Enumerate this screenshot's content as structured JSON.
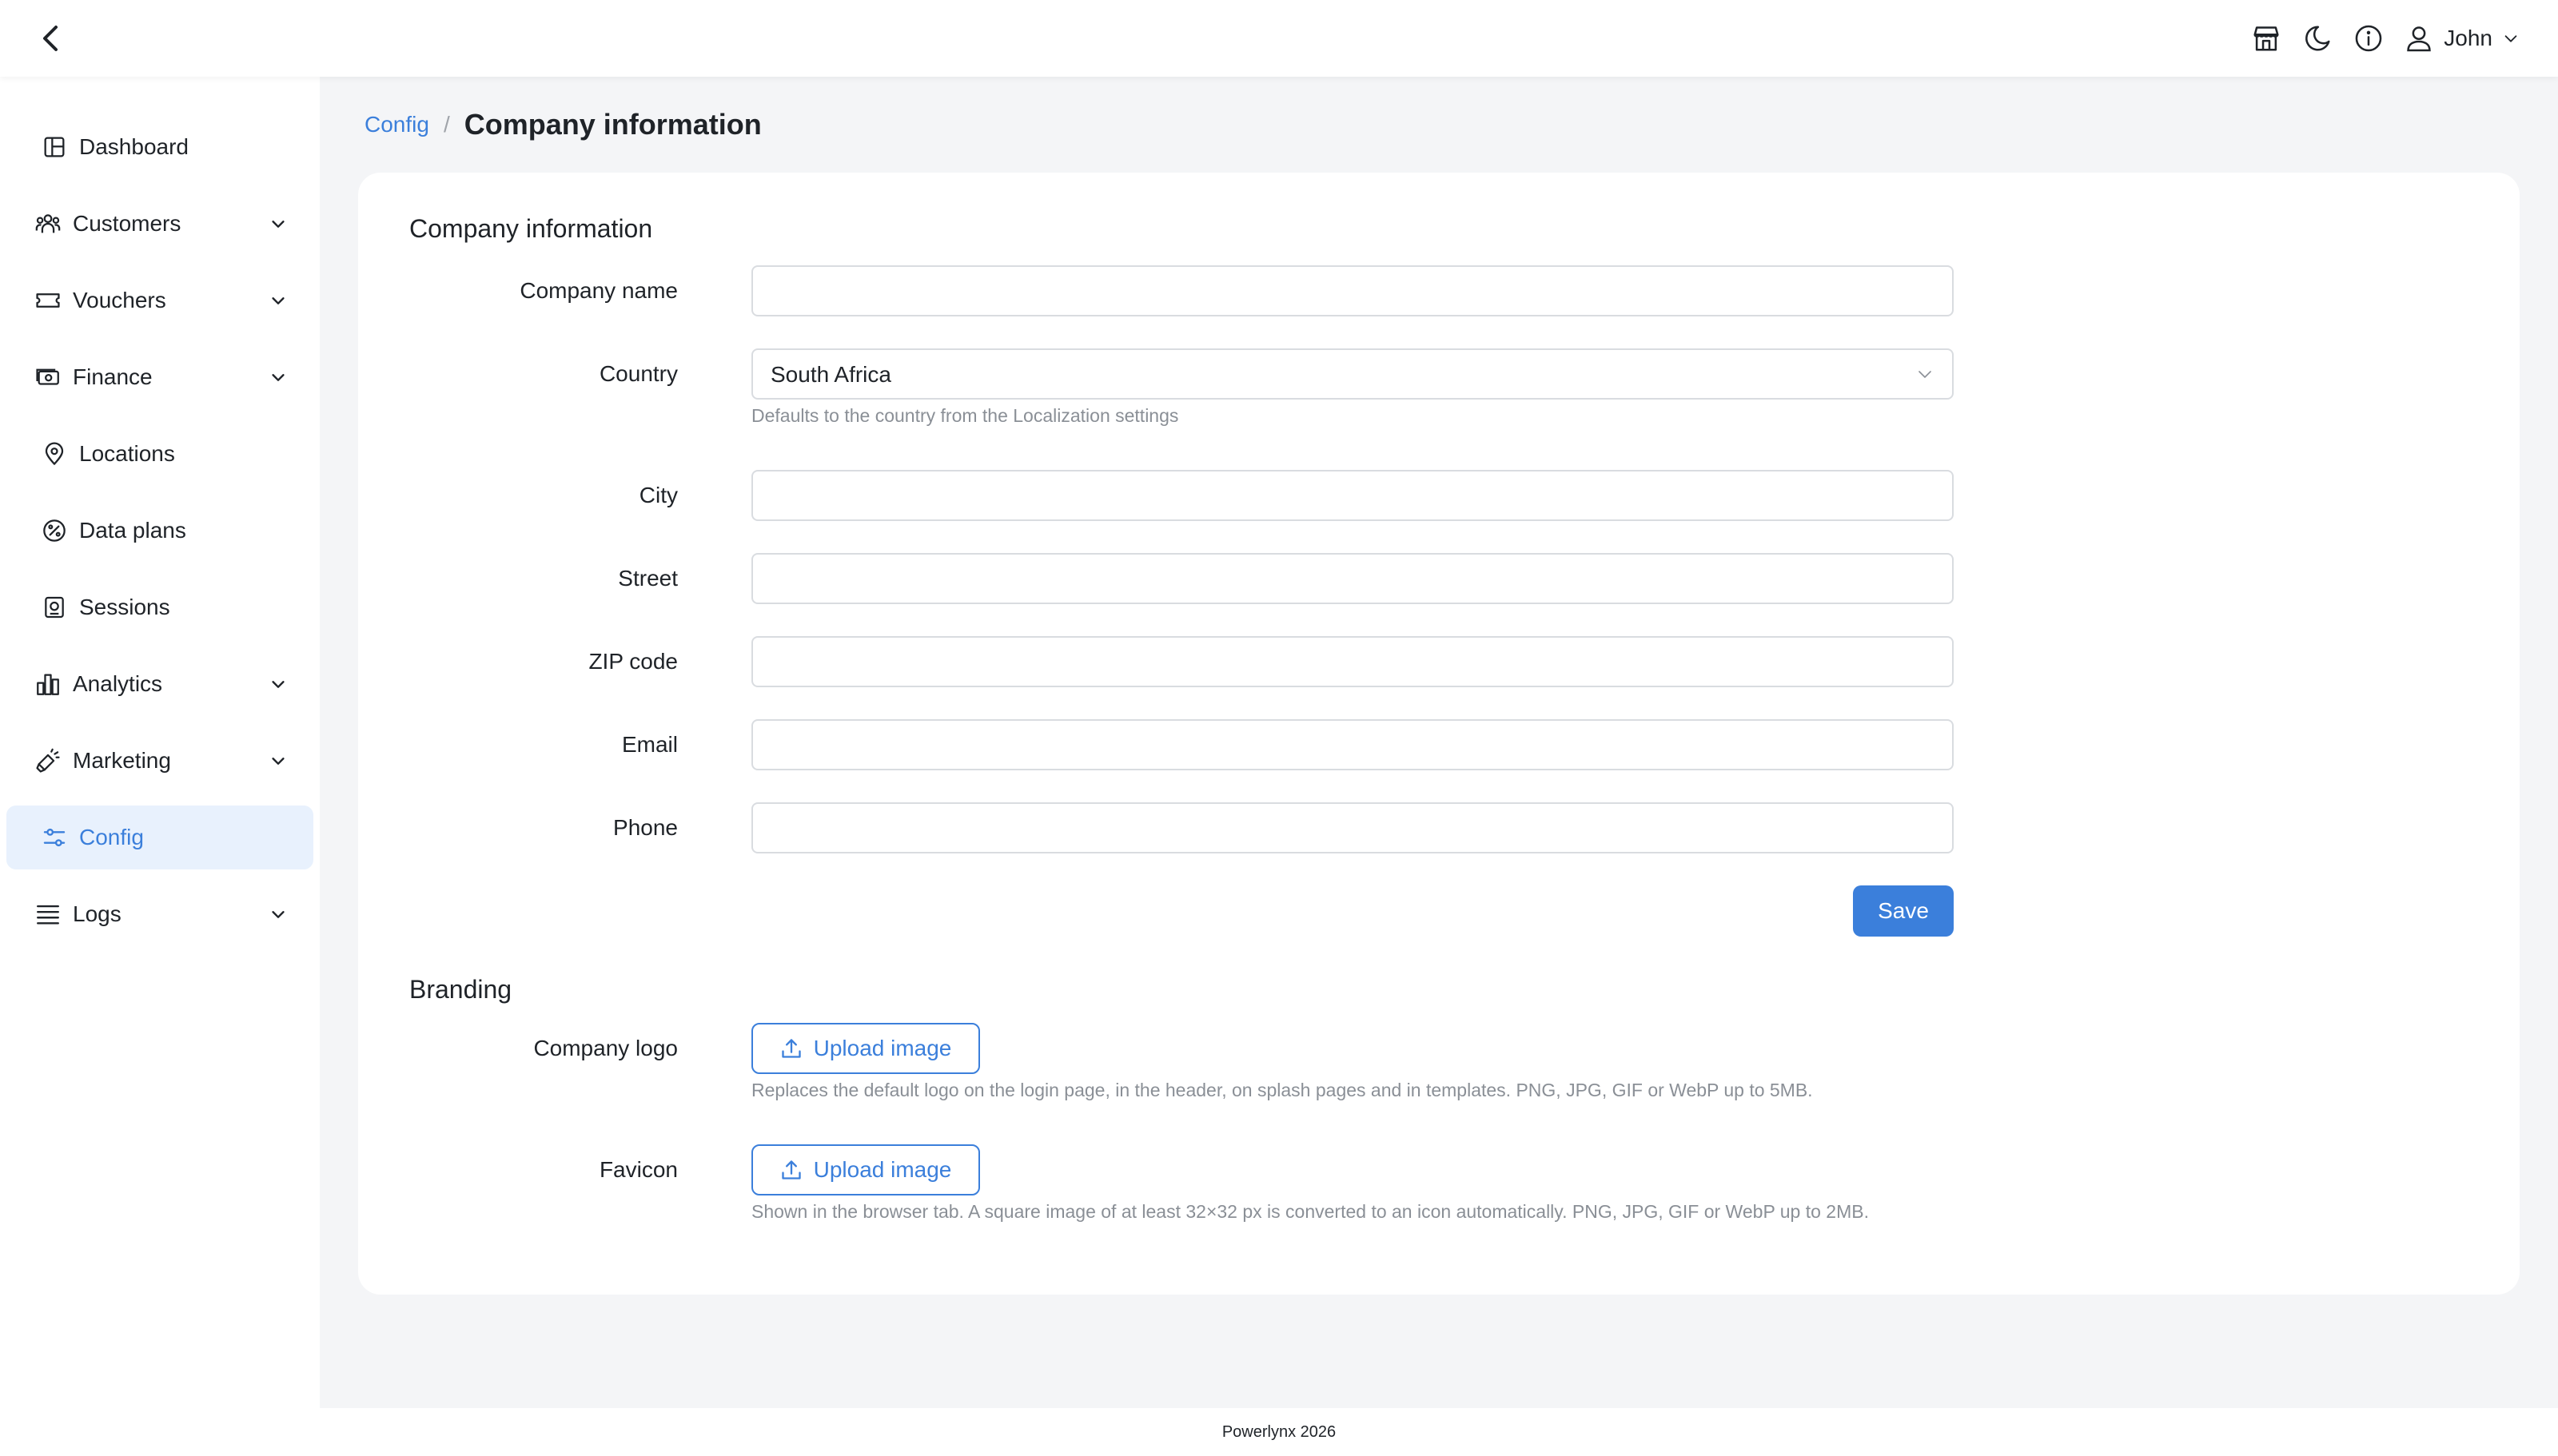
{
  "header": {
    "back_icon": "chevron-left-icon",
    "actions": [
      {
        "icon": "store-icon"
      },
      {
        "icon": "moon-icon"
      },
      {
        "icon": "info-icon"
      }
    ],
    "user": {
      "name": "John",
      "icon": "user-icon"
    }
  },
  "sidebar": {
    "items": [
      {
        "label": "Dashboard",
        "icon": "dashboard-icon",
        "expandable": false
      },
      {
        "label": "Customers",
        "icon": "users-icon",
        "expandable": true
      },
      {
        "label": "Vouchers",
        "icon": "ticket-icon",
        "expandable": true
      },
      {
        "label": "Finance",
        "icon": "cash-icon",
        "expandable": true
      },
      {
        "label": "Locations",
        "icon": "map-pin-icon",
        "expandable": false
      },
      {
        "label": "Data plans",
        "icon": "gauge-icon",
        "expandable": false
      },
      {
        "label": "Sessions",
        "icon": "sessions-icon",
        "expandable": false
      },
      {
        "label": "Analytics",
        "icon": "bar-chart-icon",
        "expandable": true
      },
      {
        "label": "Marketing",
        "icon": "megaphone-icon",
        "expandable": true
      },
      {
        "label": "Config",
        "icon": "sliders-icon",
        "expandable": false,
        "active": true
      },
      {
        "label": "Logs",
        "icon": "list-icon",
        "expandable": true
      }
    ]
  },
  "breadcrumb": {
    "parent": "Config",
    "separator": "/",
    "current": "Company information"
  },
  "company_section": {
    "title": "Company information",
    "fields": {
      "company_name": {
        "label": "Company name",
        "value": "",
        "placeholder": ""
      },
      "country": {
        "label": "Country",
        "value": "South Africa",
        "hint": "Defaults to the country from the Localization settings"
      },
      "city": {
        "label": "City",
        "value": "",
        "placeholder": ""
      },
      "street": {
        "label": "Street",
        "value": "",
        "placeholder": ""
      },
      "zip": {
        "label": "ZIP code",
        "value": "",
        "placeholder": ""
      },
      "email": {
        "label": "Email",
        "value": "",
        "placeholder": ""
      },
      "phone": {
        "label": "Phone",
        "value": "",
        "placeholder": ""
      }
    },
    "save_label": "Save"
  },
  "branding_section": {
    "title": "Branding",
    "logo": {
      "label": "Company logo",
      "button": "Upload image",
      "hint": "Replaces the default logo on the login page, in the header, on splash pages and in templates. PNG, JPG, GIF or WebP up to 5MB."
    },
    "favicon": {
      "label": "Favicon",
      "button": "Upload image",
      "hint": "Shown in the browser tab. A square image of at least 32×32 px is converted to an icon automatically. PNG, JPG, GIF or WebP up to 2MB."
    }
  },
  "footer": {
    "text": "Powerlynx 2026"
  },
  "colors": {
    "accent": "#3b7fdb",
    "active_bg": "#e8f1fd",
    "page_bg": "#f4f5f7"
  }
}
